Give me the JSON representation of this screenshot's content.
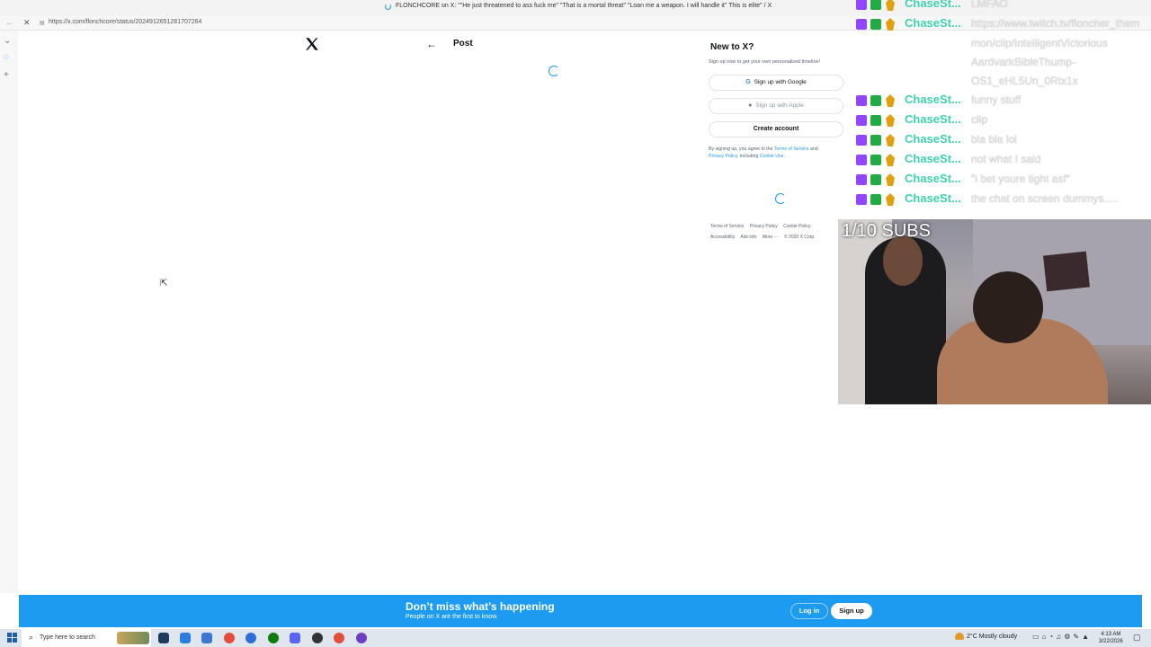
{
  "browser": {
    "tab_title": "FLONCHCORE on X: \"\"He just threatened to ass fuck me\" \"That is a mortal threat\" \"Loan me a weapon. I will handle it\" This is elite\" / X",
    "url": "https://x.com/flonchcore/status/2024912651281707264"
  },
  "x_page": {
    "header_title": "Post",
    "signup_panel": {
      "heading": "New to X?",
      "subtext": "Sign up now to get your own personalized timeline!",
      "google_label": "Sign up with Google",
      "apple_label": "Sign up with Apple",
      "create_label": "Create account",
      "terms_prefix": "By signing up, you agree to the",
      "terms_link": "Terms of Service",
      "terms_and": "and",
      "privacy_link": "Privacy Policy",
      "terms_including": ", including",
      "cookie_link": "Cookie Use."
    },
    "footer_links": [
      "Terms of Service",
      "Privacy Policy",
      "Cookie Policy",
      "Accessibility",
      "Ads info",
      "More ···",
      "© 2026 X Corp."
    ]
  },
  "chat": {
    "messages": [
      {
        "user": "ChaseSt...",
        "text": "LMFAO"
      },
      {
        "user": "ChaseSt...",
        "text": "https://www.twitch.tv/floncher_them"
      },
      {
        "user": "ChaseSt...",
        "text": "funny stuff"
      },
      {
        "user": "ChaseSt...",
        "text": "clip"
      },
      {
        "user": "ChaseSt...",
        "text": "bla bla lol"
      },
      {
        "user": "ChaseSt...",
        "text": "not what I said"
      },
      {
        "user": "ChaseSt...",
        "text": "\"i bet youre tight asf\""
      },
      {
        "user": "ChaseSt...",
        "text": "the chat on screen dummys....."
      }
    ],
    "wrap_lines": [
      "mon/clip/IntelligentVictorious",
      "AardvarkBibleThump-",
      "OS1_eHL5Un_0Rtx1x"
    ]
  },
  "stream": {
    "subs_goal": "1/10 SUBS"
  },
  "banner": {
    "heading": "Don’t miss what’s happening",
    "subtext": "People on X are the first to know.",
    "login_label": "Log in",
    "signup_label": "Sign up"
  },
  "taskbar": {
    "search_placeholder": "Type here to search",
    "weather": "2°C  Mostly cloudy",
    "time": "4:13 AM",
    "date": "3/22/2026"
  },
  "colors": {
    "x_blue": "#1d9bf0",
    "chat_name": "#3ed1b0"
  }
}
